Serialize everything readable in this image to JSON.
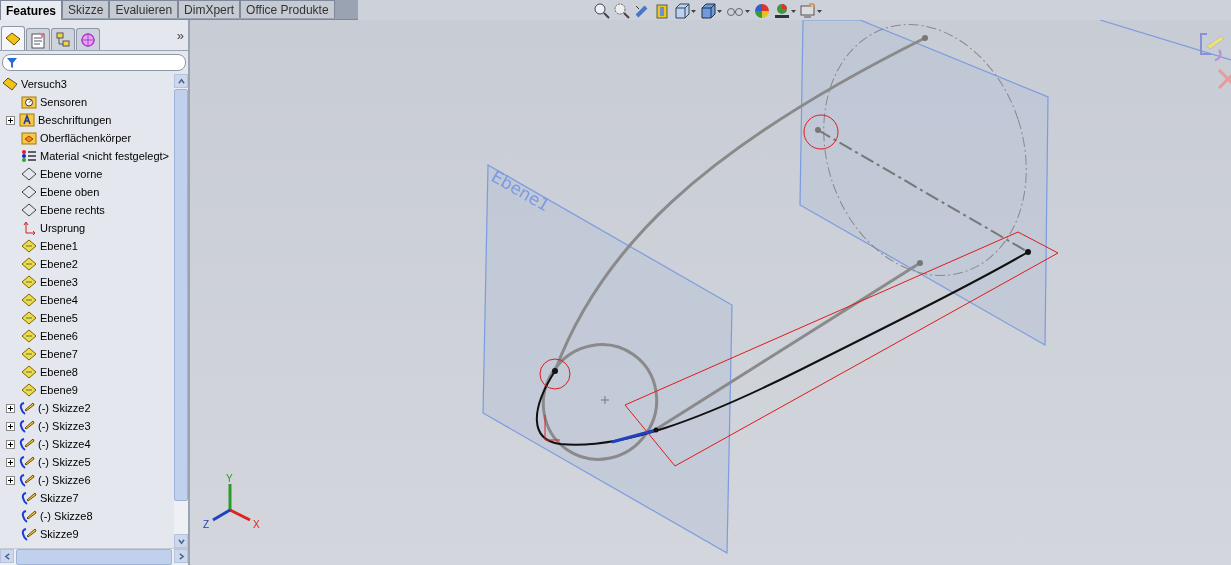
{
  "command_tabs": [
    {
      "label": "Features",
      "selected": true
    },
    {
      "label": "Skizze",
      "selected": false
    },
    {
      "label": "Evaluieren",
      "selected": false
    },
    {
      "label": "DimXpert",
      "selected": false
    },
    {
      "label": "Office Produkte",
      "selected": false
    }
  ],
  "panel_tabs": [
    {
      "kind": "feature",
      "selected": true
    },
    {
      "kind": "property",
      "selected": false
    },
    {
      "kind": "config",
      "selected": false
    },
    {
      "kind": "dimxpert",
      "selected": false
    }
  ],
  "panel_more": "»",
  "tree": {
    "label": "Versuch3",
    "kind": "part",
    "children": [
      {
        "label": "Sensoren",
        "kind": "sensor"
      },
      {
        "label": "Beschriftungen",
        "kind": "annotation",
        "expanded": false
      },
      {
        "label": "Oberflächenkörper",
        "kind": "surface"
      },
      {
        "label": "Material <nicht festgelegt>",
        "kind": "material"
      },
      {
        "label": "Ebene vorne",
        "kind": "plane"
      },
      {
        "label": "Ebene oben",
        "kind": "plane"
      },
      {
        "label": "Ebene rechts",
        "kind": "plane"
      },
      {
        "label": "Ursprung",
        "kind": "origin"
      },
      {
        "label": "Ebene1",
        "kind": "refplane"
      },
      {
        "label": "Ebene2",
        "kind": "refplane"
      },
      {
        "label": "Ebene3",
        "kind": "refplane"
      },
      {
        "label": "Ebene4",
        "kind": "refplane"
      },
      {
        "label": "Ebene5",
        "kind": "refplane"
      },
      {
        "label": "Ebene6",
        "kind": "refplane"
      },
      {
        "label": "Ebene7",
        "kind": "refplane"
      },
      {
        "label": "Ebene8",
        "kind": "refplane"
      },
      {
        "label": "Ebene9",
        "kind": "refplane"
      },
      {
        "label": "(-) Skizze2",
        "kind": "sketch",
        "expanded": false
      },
      {
        "label": "(-) Skizze3",
        "kind": "sketch",
        "expanded": false
      },
      {
        "label": "(-) Skizze4",
        "kind": "sketch",
        "expanded": false
      },
      {
        "label": "(-) Skizze5",
        "kind": "sketch",
        "expanded": false
      },
      {
        "label": "(-) Skizze6",
        "kind": "sketch",
        "expanded": false
      },
      {
        "label": "Skizze7",
        "kind": "sketch"
      },
      {
        "label": "(-) Skizze8",
        "kind": "sketch"
      },
      {
        "label": "Skizze9",
        "kind": "sketch"
      }
    ]
  },
  "viewport": {
    "plane_label": "Ebene1",
    "triad": {
      "x": "X",
      "y": "Y",
      "z": "Z"
    }
  }
}
